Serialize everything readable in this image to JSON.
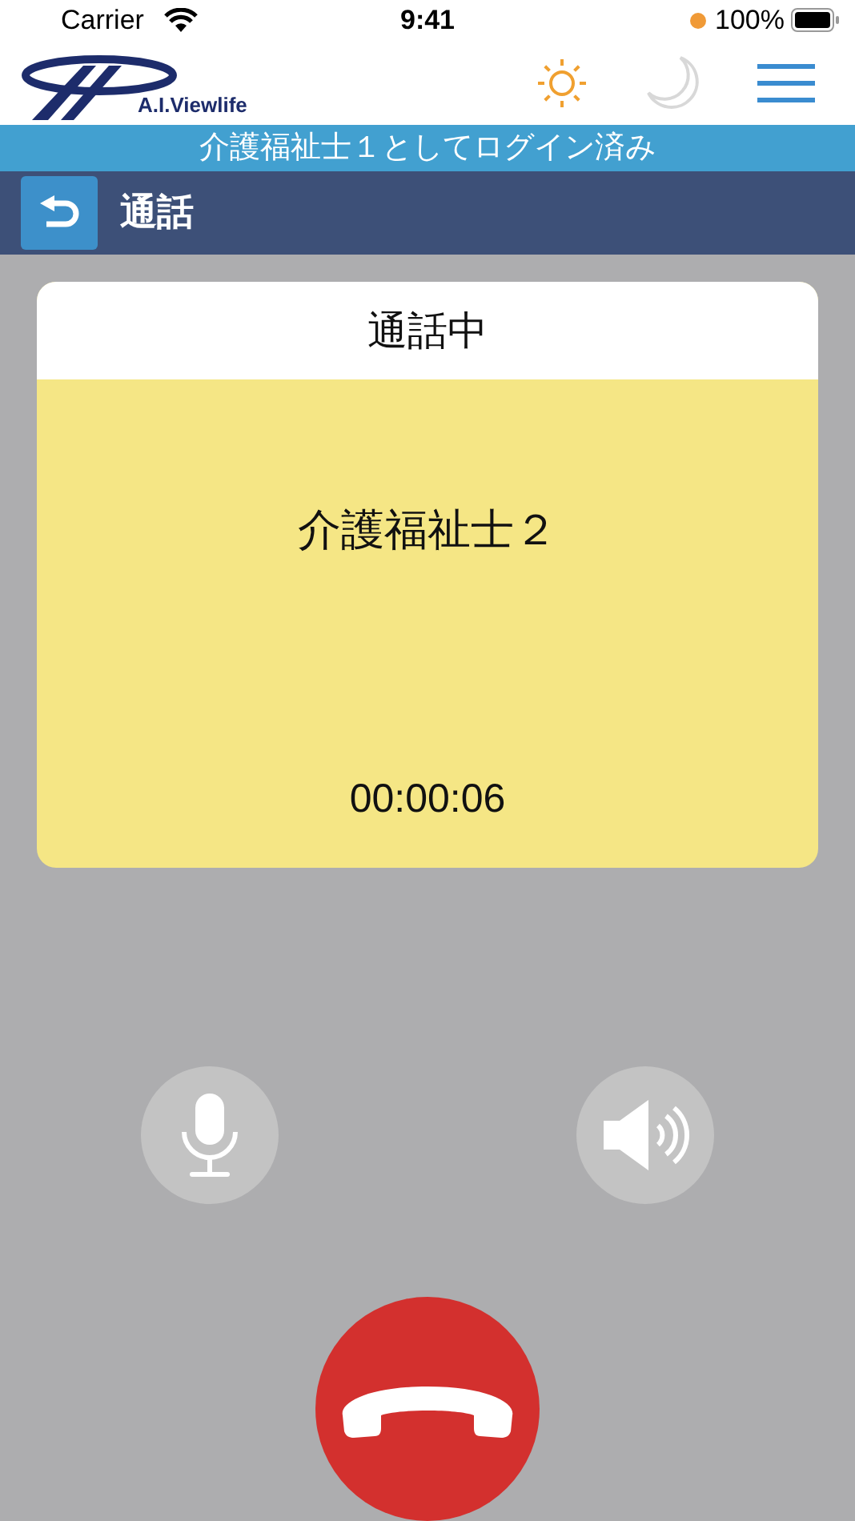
{
  "status_bar": {
    "carrier": "Carrier",
    "time": "9:41",
    "battery": "100%"
  },
  "header": {
    "logo_text": "A.I.Viewlife",
    "theme_options": [
      {
        "kind": "sun",
        "selected": true
      },
      {
        "kind": "moon",
        "selected": false
      }
    ]
  },
  "login_banner": "介護福祉士１としてログイン済み",
  "nav": {
    "title": "通話"
  },
  "call_card": {
    "status": "通話中",
    "callee": "介護福祉士２",
    "duration": "00:00:06"
  },
  "controls": [
    {
      "kind": "mic",
      "on": true
    },
    {
      "kind": "speaker",
      "on": true
    }
  ]
}
